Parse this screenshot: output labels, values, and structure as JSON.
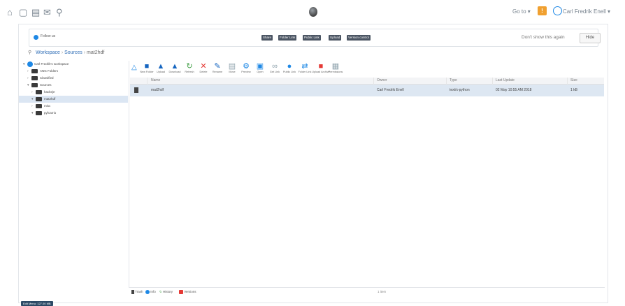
{
  "topbar": {
    "icons": [
      "home-icon",
      "folder-icon",
      "files-icon",
      "mail-icon",
      "search-icon"
    ],
    "goto_label": "Go to",
    "user_label": "Carl Fredrik Enell"
  },
  "notice": {
    "text": "Follow us",
    "pills": [
      "Share",
      "Folder Link",
      "Public Link",
      "Upload",
      "Version control"
    ],
    "dont_show": "Don't show this again",
    "hide": "Hide"
  },
  "breadcrumb": {
    "items": [
      "Workspace",
      "Sources",
      "mat2hdf"
    ]
  },
  "tree": {
    "items": [
      {
        "label": "Carl Fredrik's workspace",
        "level": 0,
        "expanded": true
      },
      {
        "label": "ANG Folders",
        "level": 1,
        "expanded": false
      },
      {
        "label": "Classified",
        "level": 1,
        "expanded": false
      },
      {
        "label": "Sources",
        "level": 1,
        "expanded": true
      },
      {
        "label": "hackeje",
        "level": 2,
        "expanded": false
      },
      {
        "label": "mat2hdf",
        "level": 2,
        "expanded": true,
        "selected": true
      },
      {
        "label": "misc",
        "level": 2,
        "expanded": false
      },
      {
        "label": "pyfcarrio",
        "level": 2,
        "expanded": true
      }
    ]
  },
  "toolbar": {
    "buttons": [
      {
        "label": "New Folder",
        "icon": "new-folder-icon",
        "color": "#1565c0"
      },
      {
        "label": "Upload",
        "icon": "upload-icon",
        "color": "#1565c0"
      },
      {
        "label": "Download",
        "icon": "download-icon",
        "color": "#1565c0"
      },
      {
        "label": "Refresh",
        "icon": "refresh-icon",
        "color": "#43a047"
      },
      {
        "label": "Delete",
        "icon": "delete-icon",
        "color": "#e53935"
      },
      {
        "label": "Rename",
        "icon": "rename-icon",
        "color": "#1565c0"
      },
      {
        "label": "Move",
        "icon": "move-icon",
        "color": "#90a4ae"
      },
      {
        "label": "Preview",
        "icon": "preview-icon",
        "color": "#1e88e5"
      },
      {
        "label": "Open",
        "icon": "open-icon",
        "color": "#1e88e5"
      },
      {
        "label": "Get Link",
        "icon": "link-icon",
        "color": "#90a4ae"
      },
      {
        "label": "Public Link",
        "icon": "globe-icon",
        "color": "#1e88e5"
      },
      {
        "label": "Folder Link",
        "icon": "folder-link-icon",
        "color": "#1e88e5"
      },
      {
        "label": "Upload Archive",
        "icon": "archive-icon",
        "color": "#e53935"
      },
      {
        "label": "Permissions",
        "icon": "permissions-icon",
        "color": "#90a4ae"
      }
    ]
  },
  "grid": {
    "columns": [
      "Name",
      "Owner",
      "Type",
      "Last Update",
      "Size"
    ],
    "rows": [
      {
        "name": "mat2hdf",
        "owner": "Carl Fredrik Enell",
        "type": "text/x-python",
        "updated": "02 May 10:55 AM 2018",
        "size": "1 kB"
      }
    ]
  },
  "status": {
    "items": [
      "Trash",
      "Info",
      "History",
      "Versions"
    ],
    "count": "1 item"
  },
  "bottom_badge": "Edit Menu: 127.00 MB"
}
